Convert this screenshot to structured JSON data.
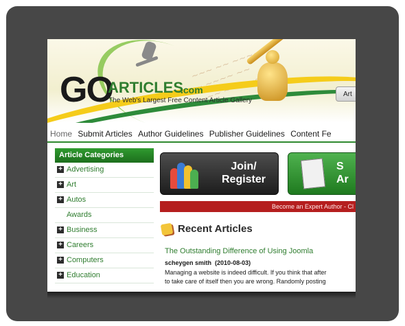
{
  "logo": {
    "go": "GO",
    "articles": "ARTICLES",
    "com": ".com",
    "tagline": "The Web's Largest Free Content Article Gallery"
  },
  "header_button_label": "Art",
  "nav": [
    "Home",
    "Submit Articles",
    "Author Guidelines",
    "Publisher Guidelines",
    "Content Fe"
  ],
  "sidebar": {
    "heading": "Article Categories",
    "items": [
      {
        "label": "Advertising",
        "expandable": true
      },
      {
        "label": "Art",
        "expandable": true
      },
      {
        "label": "Autos",
        "expandable": true
      },
      {
        "label": "Awards",
        "expandable": false
      },
      {
        "label": "Business",
        "expandable": true
      },
      {
        "label": "Careers",
        "expandable": true
      },
      {
        "label": "Computers",
        "expandable": true
      },
      {
        "label": "Education",
        "expandable": true
      }
    ]
  },
  "buttons": {
    "join_line1": "Join/",
    "join_line2": "Register",
    "submit_line1": "S",
    "submit_line2": "Ar"
  },
  "banner": "Become an Expert Author - Cl",
  "recent": {
    "title": "Recent Articles",
    "article_title": "The Outstanding Difference of Using Joomla",
    "article_author": "scheygen smith",
    "article_date": "(2010-08-03)",
    "article_line1": "Managing a website is indeed difficult. If you think that after",
    "article_line2": "to take care of itself then you are wrong. Randomly posting"
  }
}
